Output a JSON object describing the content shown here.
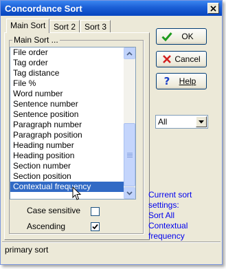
{
  "window": {
    "title": "Concordance Sort"
  },
  "tabs": [
    {
      "label": "Main Sort",
      "active": true
    },
    {
      "label": "Sort 2",
      "active": false
    },
    {
      "label": "Sort 3",
      "active": false
    }
  ],
  "main_sort": {
    "group_label": "Main Sort ...",
    "items": [
      "File order",
      "Tag order",
      "Tag distance",
      "File %",
      "Word number",
      "Sentence number",
      "Sentence position",
      "Paragraph number",
      "Paragraph position",
      "Heading number",
      "Heading position",
      "Section number",
      "Section position",
      "Contextual frequency"
    ],
    "selected_item": "Contextual frequency"
  },
  "options": {
    "case_sensitive": {
      "label": "Case sensitive",
      "checked": false
    },
    "ascending": {
      "label": "Ascending",
      "checked": true
    }
  },
  "buttons": {
    "ok": "OK",
    "cancel": "Cancel",
    "help": "Help"
  },
  "dropdown": {
    "selected": "All"
  },
  "current_sort": {
    "lines": [
      "Current sort",
      "settings:",
      "Sort All",
      "Contextual",
      "frequency"
    ]
  },
  "status": {
    "text": "primary sort"
  },
  "colors": {
    "title_bar": "#0a49c2",
    "selection": "#316ac5",
    "info_text": "#0000ee",
    "ok_check": "#1d9a1d",
    "cancel_x": "#d21e1e",
    "help_mark": "#1a3fc7"
  },
  "icons": {
    "close": "close-icon",
    "ok": "check-icon",
    "cancel": "x-icon",
    "help": "question-mark-icon",
    "dropdown": "chevron-down-icon"
  }
}
